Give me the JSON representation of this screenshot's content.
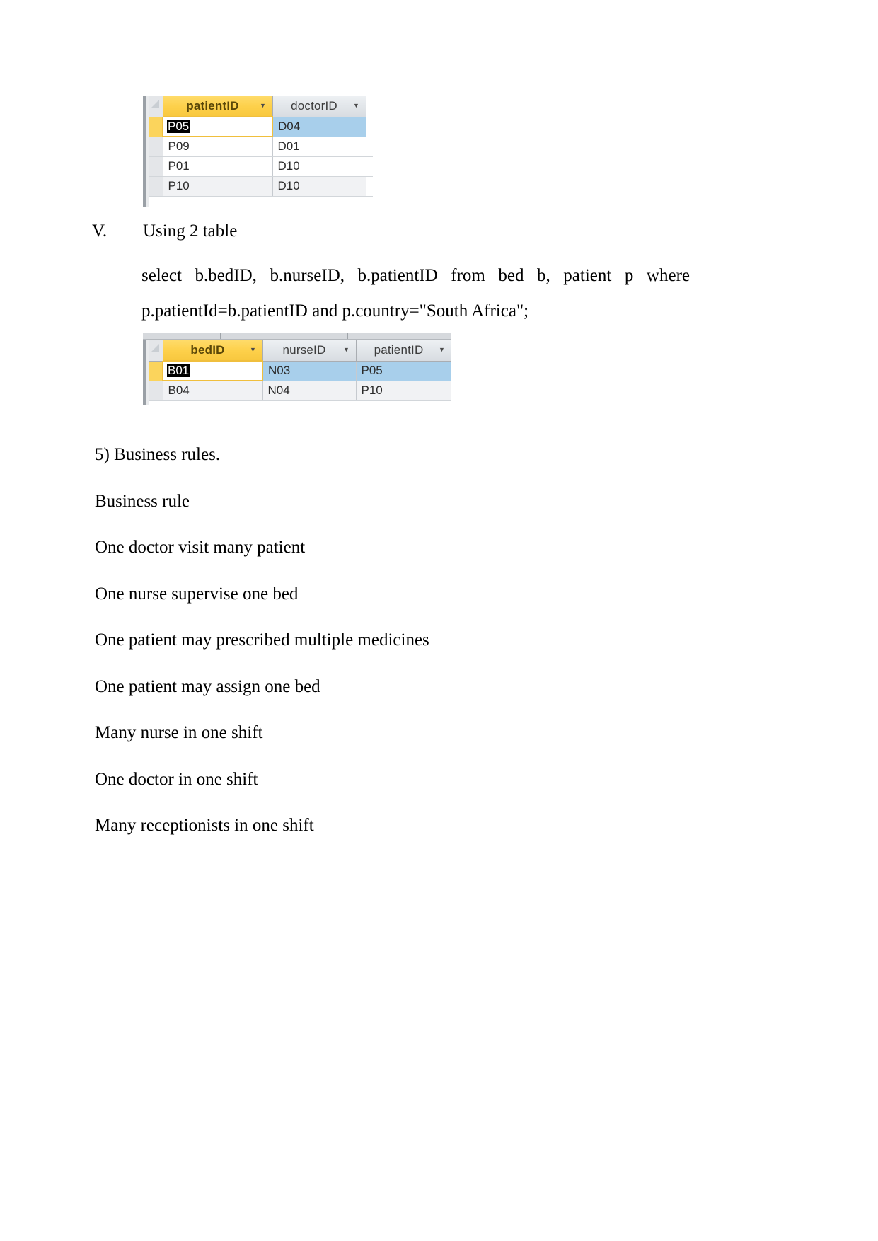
{
  "document": {
    "page_background": "#ffffff",
    "text_color": "#000000"
  },
  "table_one": {
    "name": "patient-doctor-datasheet",
    "columns": [
      {
        "label": "patientID",
        "sorted": true,
        "arrow": "chevron-down-icon"
      },
      {
        "label": "doctorID",
        "sorted": false,
        "arrow": "chevron-down-icon"
      },
      {
        "label": "",
        "sorted": false,
        "arrow": ""
      }
    ],
    "rows": [
      {
        "patientID": "P05",
        "doctorID": "D04",
        "selected": true,
        "active_cell": "patientID"
      },
      {
        "patientID": "P09",
        "doctorID": "D01",
        "selected": false
      },
      {
        "patientID": "P01",
        "doctorID": "D10",
        "selected": false
      },
      {
        "patientID": "P10",
        "doctorID": "D10",
        "selected": false
      }
    ],
    "colors": {
      "sorted_header": "#fdd04a",
      "header": "#e2e6ea",
      "selected_row": "#a8cfeb",
      "alt_row": "#f1f2f4",
      "active_border": "#f0bf3d",
      "selection_highlight": "#000000"
    }
  },
  "section": {
    "roman_numeral": "V.",
    "title": "Using 2 table",
    "sql_line_1": "select  b.bedID,  b.nurseID,  b.patientID  from  bed  b,  patient  p  where",
    "sql_line_2": "p.patientId=b.patientID and p.country=\"South Africa\";"
  },
  "table_two": {
    "name": "bed-nurse-patient-datasheet",
    "columns": [
      {
        "label": "bedID",
        "sorted": true,
        "arrow": "chevron-down-icon"
      },
      {
        "label": "nurseID",
        "sorted": false,
        "arrow": "chevron-down-icon"
      },
      {
        "label": "patientID",
        "sorted": false,
        "arrow": "chevron-down-icon"
      }
    ],
    "rows": [
      {
        "bedID": "B01",
        "nurseID": "N03",
        "patientID": "P05",
        "selected": true,
        "active_cell": "bedID"
      },
      {
        "bedID": "B04",
        "nurseID": "N04",
        "patientID": "P10",
        "selected": false
      }
    ],
    "colors": {
      "sorted_header": "#fdd04a",
      "header": "#e2e6ea",
      "selected_row": "#a8cfeb",
      "alt_row": "#f1f2f4",
      "active_border": "#f0bf3d"
    }
  },
  "business_rules": {
    "heading": "5) Business rules.",
    "subheading": "Business rule",
    "items": [
      "One doctor visit many patient",
      "One nurse supervise one bed",
      "One patient may prescribed multiple medicines",
      "One patient may assign one bed",
      "Many nurse in one shift",
      "One doctor in one shift",
      "Many receptionists in one shift"
    ]
  }
}
